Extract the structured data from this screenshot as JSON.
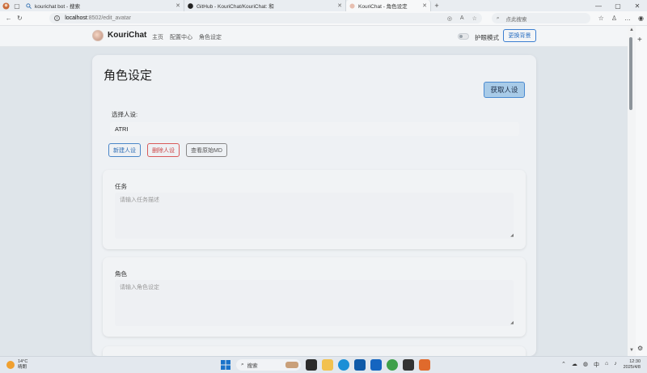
{
  "browser": {
    "tabs": [
      {
        "label": "kourichat bot - 搜索",
        "active": false
      },
      {
        "label": "GitHub - KouriChat/KouriChat: 和",
        "active": false
      },
      {
        "label": "KouriChat - 角色设定",
        "active": true
      }
    ],
    "url_host": "localhost",
    "url_path": ":8502/edit_avatar",
    "search_placeholder": "点此搜索"
  },
  "app": {
    "brand": "KouriChat",
    "nav": [
      "主页",
      "配置中心",
      "角色设定"
    ],
    "eye_mode_label": "护眼模式",
    "change_bg_label": "更换背景"
  },
  "page": {
    "title": "角色设定",
    "fetch_button": "获取人设",
    "select_label": "选择人设:",
    "selected_value": "ATRI",
    "buttons": {
      "new": "新建人设",
      "delete": "删除人设",
      "view_md": "查看原始MD"
    },
    "cards": [
      {
        "label": "任务",
        "placeholder": "请输入任务描述"
      },
      {
        "label": "角色",
        "placeholder": "请输入角色设定"
      }
    ]
  },
  "taskbar": {
    "weather_temp": "14°C",
    "weather_desc": "晴朗",
    "search_label": "搜索",
    "time": "12:30",
    "date": "2025/4/8",
    "ime": "中"
  }
}
